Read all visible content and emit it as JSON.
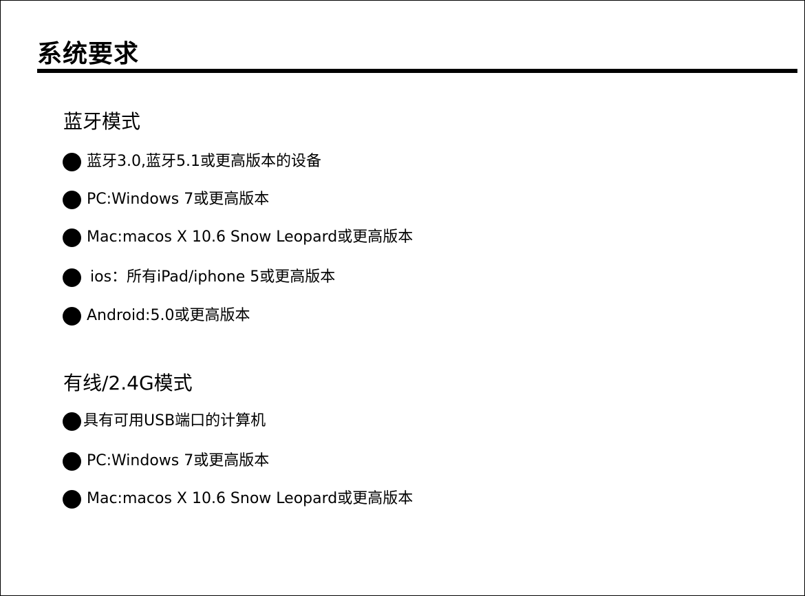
{
  "page_title": "系统要求",
  "sections": [
    {
      "title": "蓝牙模式",
      "items": [
        "蓝牙3.0,蓝牙5.1或更高版本的设备",
        "PC:Windows 7或更高版本",
        "Mac:macos X 10.6 Snow Leopard或更高版本",
        "ios：所有iPad/iphone 5或更高版本",
        "Android:5.0或更高版本"
      ]
    },
    {
      "title": "有线/2.4G模式",
      "items": [
        "具有可用USB端口的计算机",
        "PC:Windows 7或更高版本",
        "Mac:macos X 10.6 Snow Leopard或更高版本"
      ]
    }
  ],
  "colors": {
    "text": "#000000",
    "background": "#ffffff",
    "rule": "#000000"
  },
  "icons": {
    "bullet": "filled-circle-icon"
  }
}
